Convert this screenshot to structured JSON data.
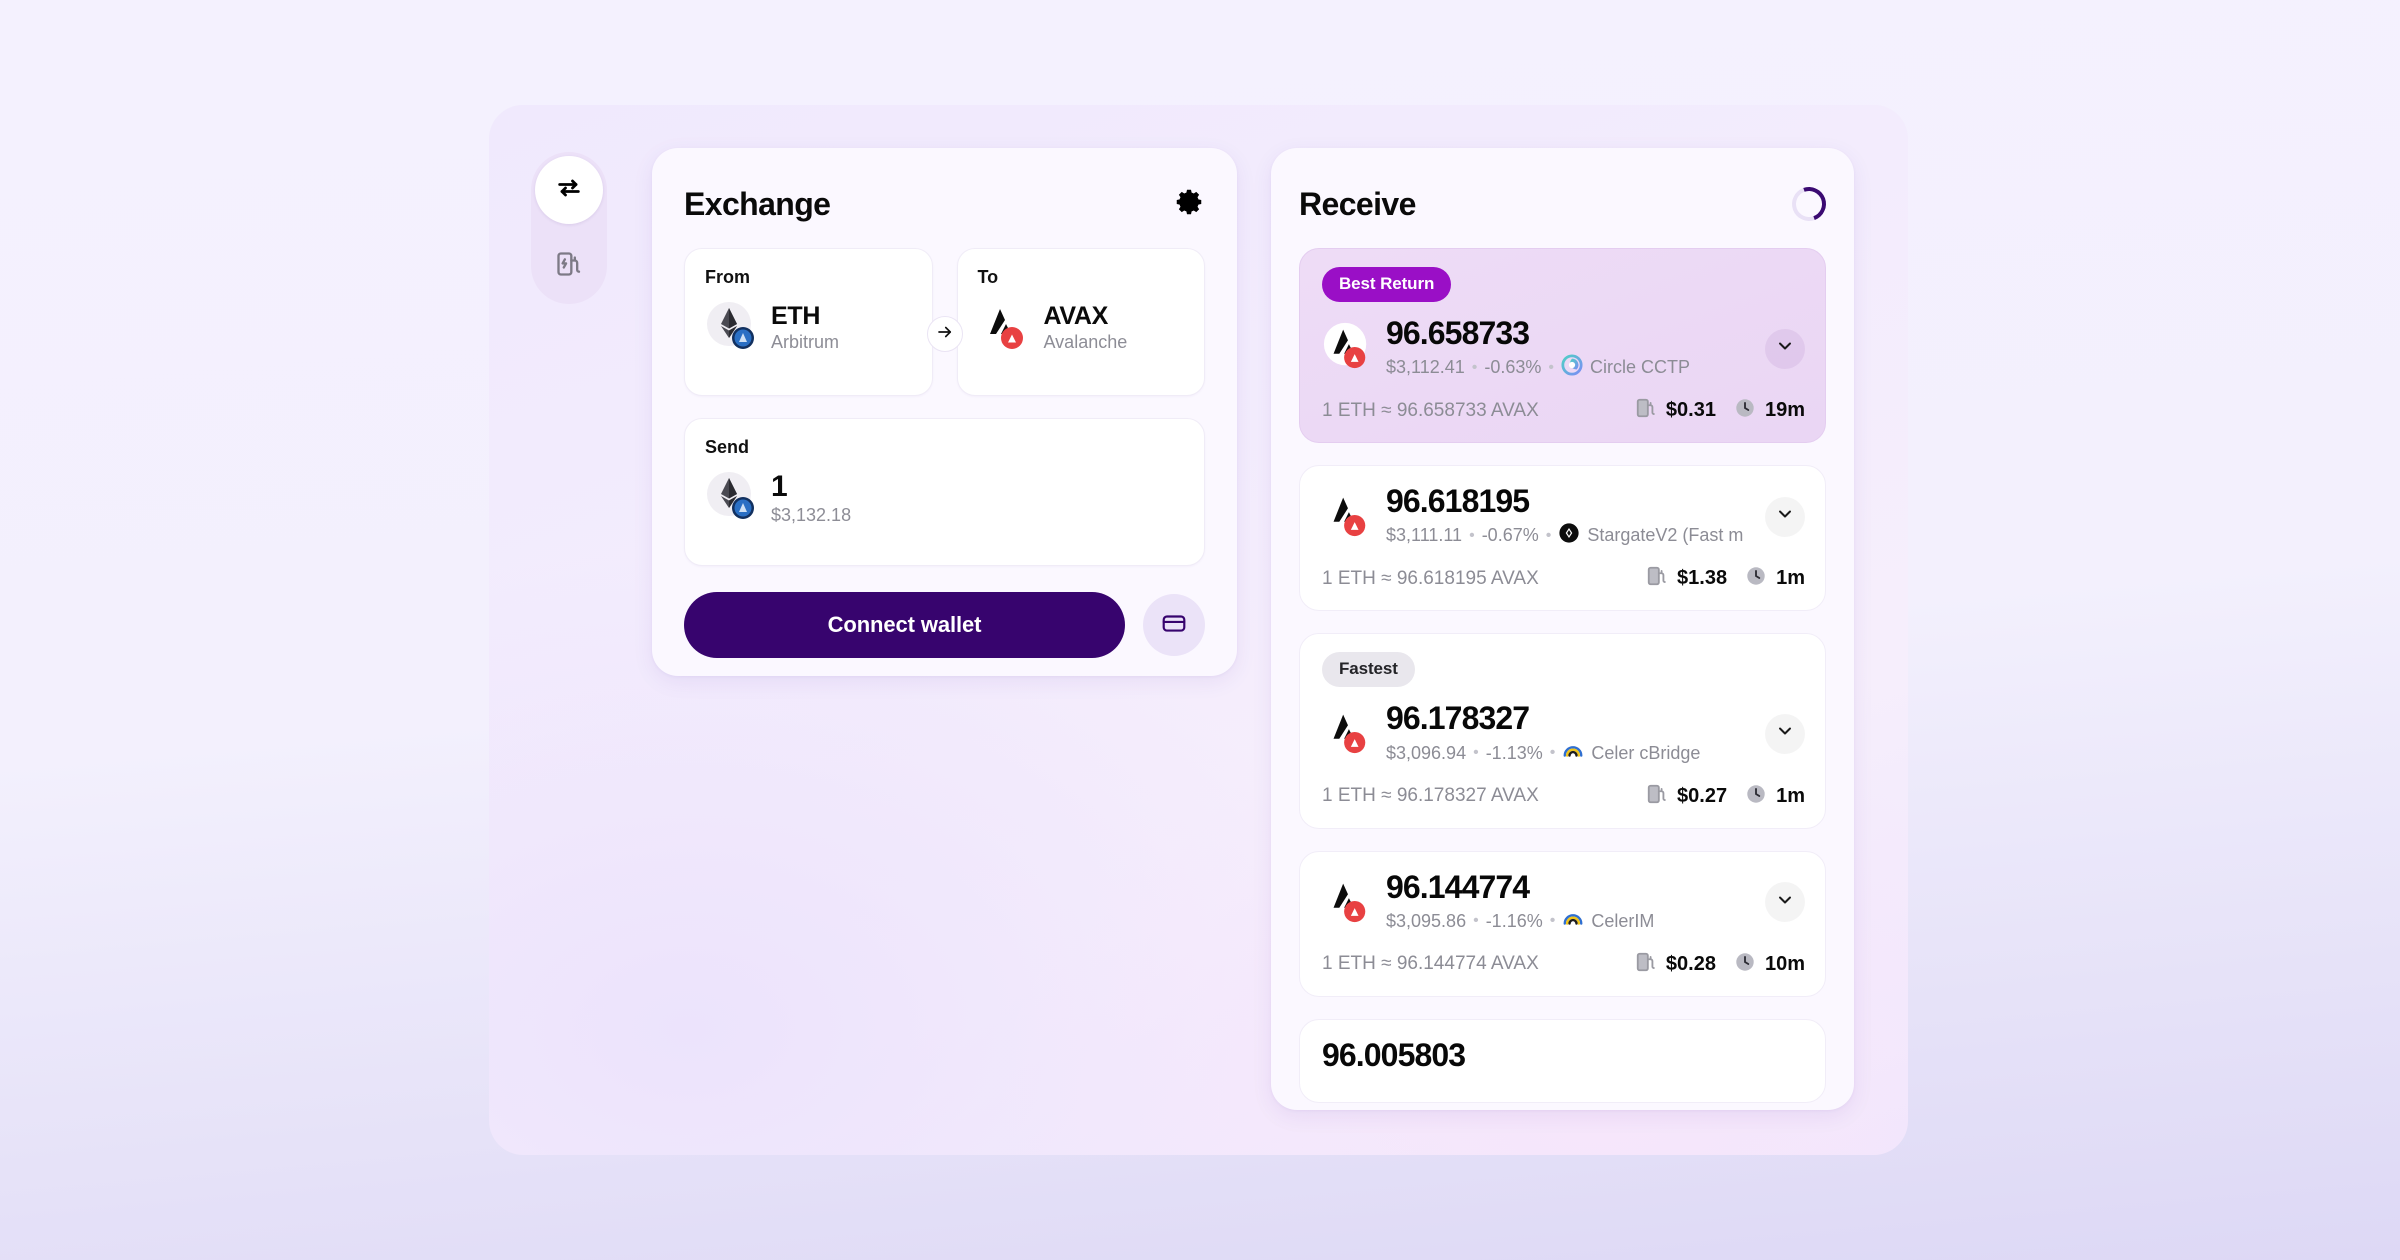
{
  "rail": {
    "swap_icon": "swap-horizontal-icon",
    "gas_icon": "gas-pump-icon"
  },
  "exchange": {
    "title": "Exchange",
    "settings_icon": "gear-icon",
    "swap_direction_icon": "arrow-right-icon",
    "from": {
      "label": "From",
      "symbol": "ETH",
      "chain": "Arbitrum",
      "token_icon": "ethereum-icon",
      "chain_badge_icon": "arbitrum-icon"
    },
    "to": {
      "label": "To",
      "symbol": "AVAX",
      "chain": "Avalanche",
      "token_icon": "avalanche-icon",
      "chain_badge_icon": "avalanche-badge-icon"
    },
    "send": {
      "label": "Send",
      "amount": "1",
      "usd": "$3,132.18",
      "token_icon": "ethereum-icon",
      "chain_badge_icon": "arbitrum-icon"
    },
    "connect_label": "Connect wallet",
    "wallet_icon": "wallet-icon"
  },
  "receive": {
    "title": "Receive",
    "loading_icon": "spinner-icon",
    "quotes": [
      {
        "badge": "Best Return",
        "amount": "96.658733",
        "usd": "$3,112.41",
        "change": "-0.63%",
        "bridge": "Circle CCTP",
        "bridge_icon": "circle-cctp-icon",
        "rate": "1 ETH ≈ 96.658733 AVAX",
        "gas": "$0.31",
        "time": "19m",
        "gas_icon": "gas-pump-icon",
        "time_icon": "clock-icon",
        "chevron_icon": "chevron-down-icon"
      },
      {
        "badge": null,
        "amount": "96.618195",
        "usd": "$3,111.11",
        "change": "-0.67%",
        "bridge": "StargateV2 (Fast m",
        "bridge_icon": "stargate-icon",
        "rate": "1 ETH ≈ 96.618195 AVAX",
        "gas": "$1.38",
        "time": "1m",
        "gas_icon": "gas-pump-icon",
        "time_icon": "clock-icon",
        "chevron_icon": "chevron-down-icon"
      },
      {
        "badge": "Fastest",
        "amount": "96.178327",
        "usd": "$3,096.94",
        "change": "-1.13%",
        "bridge": "Celer cBridge",
        "bridge_icon": "celer-icon",
        "rate": "1 ETH ≈ 96.178327 AVAX",
        "gas": "$0.27",
        "time": "1m",
        "gas_icon": "gas-pump-icon",
        "time_icon": "clock-icon",
        "chevron_icon": "chevron-down-icon"
      },
      {
        "badge": null,
        "amount": "96.144774",
        "usd": "$3,095.86",
        "change": "-1.16%",
        "bridge": "CelerIM",
        "bridge_icon": "celer-icon",
        "rate": "1 ETH ≈ 96.144774 AVAX",
        "gas": "$0.28",
        "time": "10m",
        "gas_icon": "gas-pump-icon",
        "time_icon": "clock-icon",
        "chevron_icon": "chevron-down-icon"
      }
    ],
    "clipped_quote": {
      "amount": "96.005803"
    }
  },
  "colors": {
    "accent_purple": "#37046e",
    "badge_purple": "#9a0fc6",
    "avalanche_red": "#e84142",
    "page_bg": "#f2f0fe"
  }
}
